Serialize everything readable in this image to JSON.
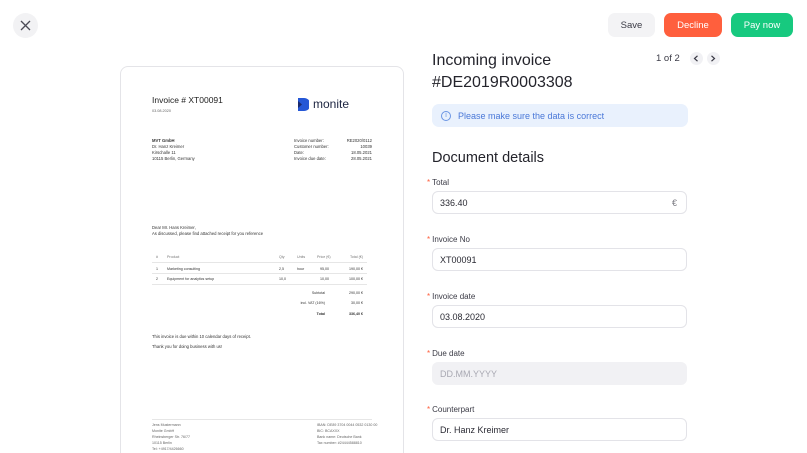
{
  "toolbar": {
    "save_label": "Save",
    "decline_label": "Decline",
    "pay_label": "Pay now"
  },
  "pager": {
    "text": "1 of 2"
  },
  "header": {
    "title_line1": "Incoming invoice",
    "title_line2": "#DE2019R0003308"
  },
  "notice": {
    "text": "Please make sure the data is correct"
  },
  "details": {
    "title": "Document details",
    "fields": {
      "total": {
        "label": "Total",
        "value": "336.40",
        "suffix": "€"
      },
      "invoice_no": {
        "label": "Invoice No",
        "value": "XT00091"
      },
      "invoice_date": {
        "label": "Invoice date",
        "value": "03.08.2020"
      },
      "due_date": {
        "label": "Due date",
        "placeholder": "DD.MM.YYYY"
      },
      "counterpart": {
        "label": "Counterpart",
        "value": "Dr. Hanz Kreimer"
      }
    }
  },
  "document": {
    "title": "Invoice # XT00091",
    "date": "03.08.2020",
    "logo_text": "monite",
    "sender": [
      "MVT GmbH",
      "Dr. Hanz Kreimer",
      "Kirschalle 11",
      "10115 Berlin, Germany"
    ],
    "meta_labels": [
      "Invoice number:",
      "Customer number:",
      "Date:",
      "Invoice due date:"
    ],
    "meta_values": [
      "RE2020/0112",
      "10039",
      "18.05.2021",
      "28.05.2021"
    ],
    "greeting": "Dear Mr. Hans Kreimer,",
    "intro": "As discussed, please find attached receipt for you reference",
    "table_headers": [
      "#",
      "Product",
      "Qty",
      "Units",
      "Price (€)",
      "Total (€)"
    ],
    "rows": [
      [
        "1",
        "Marketing consulting",
        "2,5",
        "hour",
        "95,00",
        "190,00 €"
      ],
      [
        "2",
        "Equipment for analytics setup",
        "10,0",
        "",
        "10,00",
        "100,00 €"
      ]
    ],
    "totals_labels": [
      "Subtotal",
      "incl. VAT (16%)",
      "Total"
    ],
    "totals_values": [
      "290,00 €",
      "30,00 €",
      "336,40 €"
    ],
    "note1": "This invoice is due within 10 calendar days of receipt.",
    "note2": "Thank you for doing business with us!",
    "footer_left": [
      "Jens Mustermann",
      "Monite GmbH",
      "Rheinsberger Str. 76/77",
      "10115 Berlin",
      "Tel: +4917/4426660"
    ],
    "footer_right": [
      "IBAN: DE89 3704 0044 0532 0130 00",
      "BIC: BCAXXX",
      "Bank name: Deutsche Bank",
      "Tax number: #24444588810"
    ]
  }
}
